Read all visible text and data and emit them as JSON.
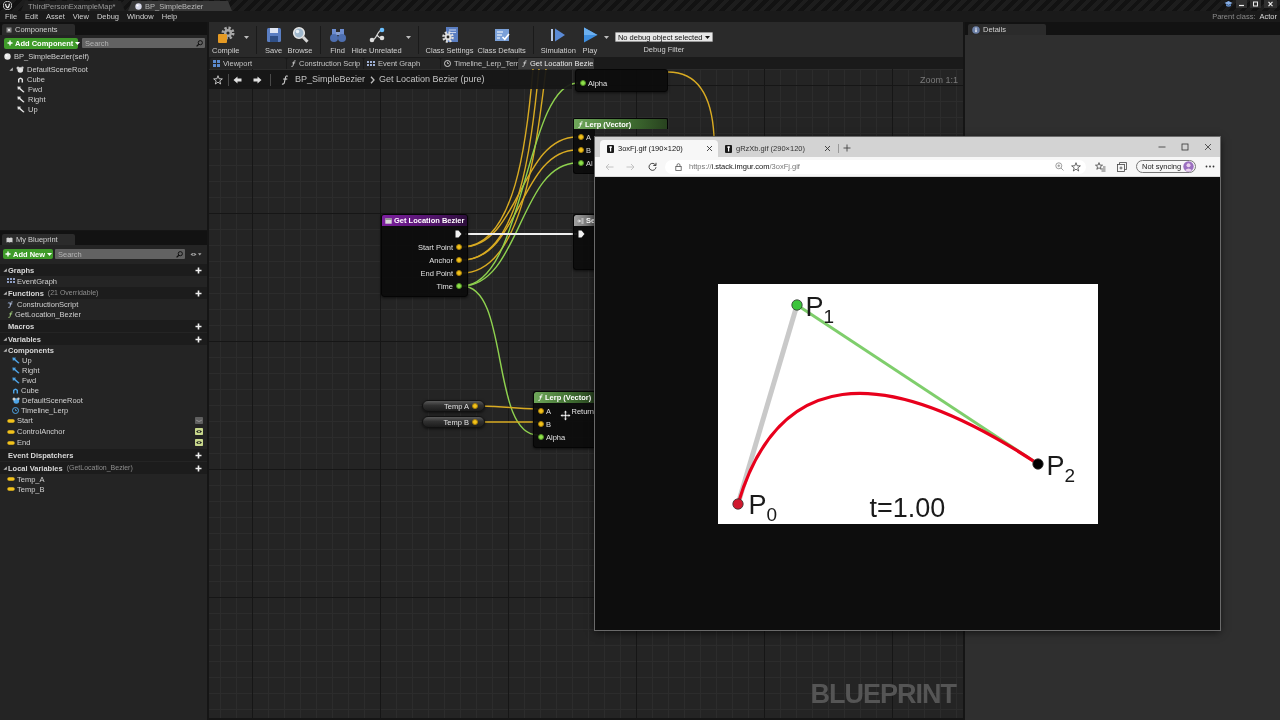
{
  "title_bar": {
    "tabs": [
      {
        "label": "ThirdPersonExampleMap*",
        "kind": "level",
        "selected": false
      },
      {
        "label": "BP_SimpleBezier",
        "kind": "blueprint",
        "selected": true
      }
    ]
  },
  "menu": [
    "File",
    "Edit",
    "Asset",
    "View",
    "Debug",
    "Window",
    "Help"
  ],
  "parent_class": {
    "label": "Parent class:",
    "value": "Actor"
  },
  "components": {
    "title": "Components",
    "add_button": "Add Component",
    "search": {
      "placeholder": "Search"
    },
    "tree": [
      {
        "label": "BP_SimpleBezier(self)",
        "kind": "self"
      },
      {
        "label": "DefaultSceneRoot",
        "kind": "scene",
        "expanded": true,
        "children": [
          {
            "label": "Cube",
            "kind": "mesh"
          },
          {
            "label": "Fwd",
            "kind": "arrow"
          },
          {
            "label": "Right",
            "kind": "arrow"
          },
          {
            "label": "Up",
            "kind": "arrow"
          }
        ]
      }
    ]
  },
  "my_blueprint": {
    "title": "My Blueprint",
    "add_button": "Add New",
    "search": {
      "placeholder": "Search"
    },
    "sections": [
      {
        "label": "Graphs",
        "expanded": true,
        "addable": true,
        "items": [
          {
            "label": "EventGraph",
            "kind": "graph"
          }
        ]
      },
      {
        "label": "Functions",
        "note": "(21 Overridable)",
        "expanded": true,
        "addable": true,
        "items": [
          {
            "label": "ConstructionScript",
            "kind": "construction"
          },
          {
            "label": "GetLocation_Bezier",
            "kind": "function"
          }
        ]
      },
      {
        "label": "Macros",
        "addable": true
      },
      {
        "label": "Variables",
        "expanded": true,
        "addable": true,
        "items": [
          {
            "label": "Components",
            "kind": "category",
            "expanded": true,
            "children": [
              {
                "label": "Up",
                "kind": "arrow"
              },
              {
                "label": "Right",
                "kind": "arrow"
              },
              {
                "label": "Fwd",
                "kind": "arrow"
              },
              {
                "label": "Cube",
                "kind": "mesh"
              },
              {
                "label": "DefaultSceneRoot",
                "kind": "scene"
              },
              {
                "label": "Timeline_Lerp",
                "kind": "timeline"
              }
            ]
          },
          {
            "label": "Start",
            "kind": "vector",
            "exposed": false
          },
          {
            "label": "ControlAnchor",
            "kind": "vector",
            "exposed": true
          },
          {
            "label": "End",
            "kind": "vector",
            "exposed": true
          }
        ]
      },
      {
        "label": "Event Dispatchers",
        "addable": true
      },
      {
        "label": "Local Variables",
        "note": "(GetLocation_Bezier)",
        "expanded": true,
        "addable": true,
        "items": [
          {
            "label": "Temp_A",
            "kind": "vector"
          },
          {
            "label": "Temp_B",
            "kind": "vector"
          }
        ]
      }
    ]
  },
  "toolbar": {
    "groups": [
      [
        {
          "label": "Compile",
          "kind": "compile",
          "dropdown": true
        }
      ],
      [
        {
          "label": "Save",
          "kind": "save",
          "dropdown": false
        },
        {
          "label": "Browse",
          "kind": "browse",
          "dropdown": false
        }
      ],
      [
        {
          "label": "Find",
          "kind": "find",
          "dropdown": false
        },
        {
          "label": "Hide Unrelated",
          "kind": "hide_unrelated",
          "dropdown": true
        }
      ],
      [
        {
          "label": "Class Settings",
          "kind": "class_settings",
          "dropdown": false
        },
        {
          "label": "Class Defaults",
          "kind": "class_defaults",
          "dropdown": false
        }
      ],
      [
        {
          "label": "Simulation",
          "kind": "simulation",
          "dropdown": false
        },
        {
          "label": "Play",
          "kind": "play",
          "dropdown": true
        }
      ]
    ],
    "debug_filter": {
      "value": "No debug object selected",
      "label": "Debug Filter"
    }
  },
  "editor_tabs": [
    {
      "label": "Viewport",
      "kind": "viewport",
      "selected": false
    },
    {
      "label": "Construction Scrip",
      "kind": "function",
      "selected": false
    },
    {
      "label": "Event Graph",
      "kind": "graph",
      "selected": false
    },
    {
      "label": "Timeline_Lerp_Terr",
      "kind": "timeline",
      "selected": false
    },
    {
      "label": "Get Location Bezie",
      "kind": "function",
      "selected": true
    }
  ],
  "graph": {
    "breadcrumb": {
      "blueprint": "BP_SimpleBezier",
      "graph": "Get Location Bezier (pure)"
    },
    "zoom": "Zoom 1:1",
    "nodes": [
      {
        "kind": "partial",
        "inputs": [
          {
            "label": "Alpha",
            "kind": "float"
          }
        ]
      },
      {
        "kind": "function",
        "title": "Lerp (Vector)",
        "inputs": [
          {
            "label": "A",
            "kind": "vector"
          },
          {
            "label": "B",
            "kind": "vector"
          },
          {
            "label": "Al",
            "kind": "float"
          }
        ]
      },
      {
        "kind": "entry",
        "title": "Get Location Bezier",
        "outputs": [
          {
            "kind": "exec"
          },
          {
            "label": "Start Point",
            "kind": "vector"
          },
          {
            "label": "Anchor",
            "kind": "vector"
          },
          {
            "label": "End Point",
            "kind": "vector"
          },
          {
            "label": "Time",
            "kind": "float"
          }
        ]
      },
      {
        "kind": "setter",
        "title": "Se",
        "inputs": [
          {
            "kind": "exec"
          }
        ]
      },
      {
        "kind": "getter",
        "title": "Temp A",
        "outputs": [
          {
            "kind": "vector"
          }
        ]
      },
      {
        "kind": "getter",
        "title": "Temp B",
        "outputs": [
          {
            "kind": "vector"
          }
        ]
      },
      {
        "kind": "function",
        "title": "Lerp (Vector)",
        "inputs": [
          {
            "label": "A",
            "kind": "vector"
          },
          {
            "label": "B",
            "kind": "vector"
          },
          {
            "label": "Alpha",
            "kind": "float"
          }
        ],
        "outputs": [
          {
            "label": "Return"
          }
        ]
      }
    ],
    "graph_type_label": "BLUEPRINT"
  },
  "details": {
    "title": "Details"
  },
  "browser": {
    "tabs": [
      {
        "label": "3oxFj.gif (190×120)",
        "selected": true
      },
      {
        "label": "gRzXb.gif (290×120)",
        "selected": false
      }
    ],
    "back": {
      "disabled": true
    },
    "forward": {
      "disabled": true
    },
    "url": {
      "scheme": "https://",
      "host": "i.stack.imgur.com",
      "path": "/3oxFj.gif"
    },
    "sync": "Not syncing",
    "image": {
      "points": [
        {
          "label": "P$_{0}$",
          "color": "#d0182e"
        },
        {
          "label": "P$_{1}$",
          "color": "#3cc43c"
        },
        {
          "label": "P$_{2}$",
          "color": "#000000"
        }
      ],
      "caption": "t=1.00"
    }
  }
}
